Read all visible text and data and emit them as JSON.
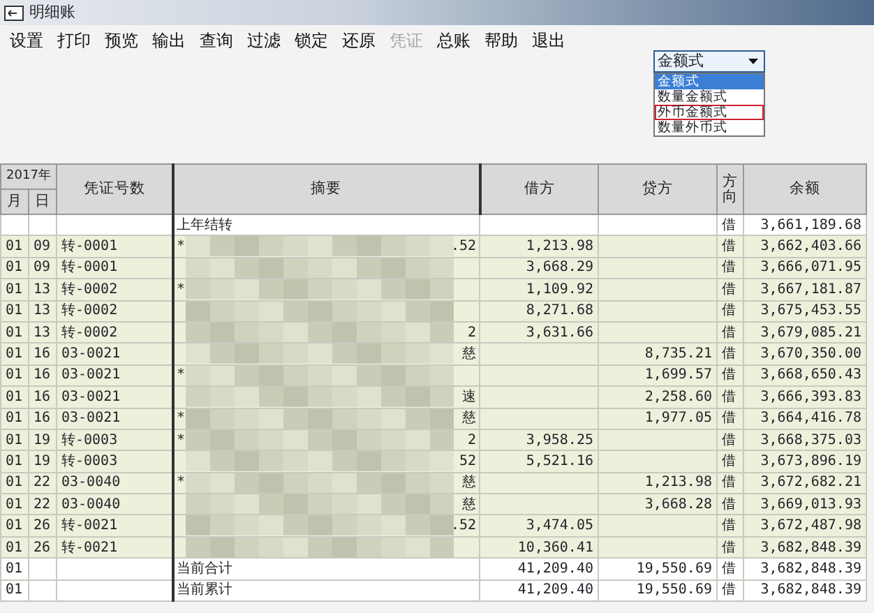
{
  "window": {
    "title": "明细账"
  },
  "menu": [
    {
      "label": "设置",
      "disabled": false
    },
    {
      "label": "打印",
      "disabled": false
    },
    {
      "label": "预览",
      "disabled": false
    },
    {
      "label": "输出",
      "disabled": false
    },
    {
      "label": "查询",
      "disabled": false
    },
    {
      "label": "过滤",
      "disabled": false
    },
    {
      "label": "锁定",
      "disabled": false
    },
    {
      "label": "还原",
      "disabled": false
    },
    {
      "label": "凭证",
      "disabled": true
    },
    {
      "label": "总账",
      "disabled": false
    },
    {
      "label": "帮助",
      "disabled": false
    },
    {
      "label": "退出",
      "disabled": false
    }
  ],
  "format_select": {
    "value": "金额式",
    "expanded": true,
    "options": [
      {
        "label": "金额式",
        "selected": true,
        "outlined": false
      },
      {
        "label": "数量金额式",
        "selected": false,
        "outlined": false
      },
      {
        "label": "外币金额式",
        "selected": false,
        "outlined": true
      },
      {
        "label": "数量外币式",
        "selected": false,
        "outlined": false
      }
    ]
  },
  "table": {
    "year": "2017年",
    "columns": [
      "月",
      "日",
      "凭证号数",
      "摘要",
      "借方",
      "贷方",
      "方向",
      "余额"
    ],
    "rows": [
      {
        "kind": "plain",
        "month": "",
        "day": "",
        "voucher": "",
        "summary": "上年结转",
        "summary_end": "",
        "debit": "",
        "credit": "",
        "direction": "借",
        "balance": "3,661,189.68"
      },
      {
        "kind": "blurred",
        "month": "01",
        "day": "09",
        "voucher": "转-0001",
        "summary": "*",
        "summary_end": ".52",
        "debit": "1,213.98",
        "credit": "",
        "direction": "借",
        "balance": "3,662,403.66"
      },
      {
        "kind": "blurred",
        "month": "01",
        "day": "09",
        "voucher": "转-0001",
        "summary": "",
        "summary_end": "",
        "debit": "3,668.29",
        "credit": "",
        "direction": "借",
        "balance": "3,666,071.95"
      },
      {
        "kind": "blurred",
        "month": "01",
        "day": "13",
        "voucher": "转-0002",
        "summary": "*",
        "summary_end": "",
        "debit": "1,109.92",
        "credit": "",
        "direction": "借",
        "balance": "3,667,181.87"
      },
      {
        "kind": "blurred",
        "month": "01",
        "day": "13",
        "voucher": "转-0002",
        "summary": "",
        "summary_end": "",
        "debit": "8,271.68",
        "credit": "",
        "direction": "借",
        "balance": "3,675,453.55"
      },
      {
        "kind": "blurred",
        "month": "01",
        "day": "13",
        "voucher": "转-0002",
        "summary": "",
        "summary_end": "2",
        "debit": "3,631.66",
        "credit": "",
        "direction": "借",
        "balance": "3,679,085.21"
      },
      {
        "kind": "blurred",
        "month": "01",
        "day": "16",
        "voucher": "03-0021",
        "summary": "",
        "summary_end": "慈",
        "debit": "",
        "credit": "8,735.21",
        "direction": "借",
        "balance": "3,670,350.00"
      },
      {
        "kind": "blurred",
        "month": "01",
        "day": "16",
        "voucher": "03-0021",
        "summary": "*",
        "summary_end": "",
        "debit": "",
        "credit": "1,699.57",
        "direction": "借",
        "balance": "3,668,650.43"
      },
      {
        "kind": "blurred",
        "month": "01",
        "day": "16",
        "voucher": "03-0021",
        "summary": "",
        "summary_end": "速",
        "debit": "",
        "credit": "2,258.60",
        "direction": "借",
        "balance": "3,666,393.83"
      },
      {
        "kind": "blurred",
        "month": "01",
        "day": "16",
        "voucher": "03-0021",
        "summary": "*",
        "summary_end": "慈",
        "debit": "",
        "credit": "1,977.05",
        "direction": "借",
        "balance": "3,664,416.78"
      },
      {
        "kind": "blurred",
        "month": "01",
        "day": "19",
        "voucher": "转-0003",
        "summary": "*",
        "summary_end": "2",
        "debit": "3,958.25",
        "credit": "",
        "direction": "借",
        "balance": "3,668,375.03"
      },
      {
        "kind": "blurred",
        "month": "01",
        "day": "19",
        "voucher": "转-0003",
        "summary": "",
        "summary_end": "52",
        "debit": "5,521.16",
        "credit": "",
        "direction": "借",
        "balance": "3,673,896.19"
      },
      {
        "kind": "blurred",
        "month": "01",
        "day": "22",
        "voucher": "03-0040",
        "summary": "*",
        "summary_end": "慈",
        "debit": "",
        "credit": "1,213.98",
        "direction": "借",
        "balance": "3,672,682.21"
      },
      {
        "kind": "blurred",
        "month": "01",
        "day": "22",
        "voucher": "03-0040",
        "summary": "",
        "summary_end": "慈",
        "debit": "",
        "credit": "3,668.28",
        "direction": "借",
        "balance": "3,669,013.93"
      },
      {
        "kind": "blurred",
        "month": "01",
        "day": "26",
        "voucher": "转-0021",
        "summary": "",
        "summary_end": ".52",
        "debit": "3,474.05",
        "credit": "",
        "direction": "借",
        "balance": "3,672,487.98"
      },
      {
        "kind": "blurred",
        "month": "01",
        "day": "26",
        "voucher": "转-0021",
        "summary": "",
        "summary_end": "",
        "debit": "10,360.41",
        "credit": "",
        "direction": "借",
        "balance": "3,682,848.39"
      },
      {
        "kind": "plain",
        "month": "01",
        "day": "",
        "voucher": "",
        "summary": "当前合计",
        "summary_end": "",
        "debit": "41,209.40",
        "credit": "19,550.69",
        "direction": "借",
        "balance": "3,682,848.39"
      },
      {
        "kind": "plain",
        "month": "01",
        "day": "",
        "voucher": "",
        "summary": "当前累计",
        "summary_end": "",
        "debit": "41,209.40",
        "credit": "19,550.69",
        "direction": "借",
        "balance": "3,682,848.39"
      }
    ]
  }
}
